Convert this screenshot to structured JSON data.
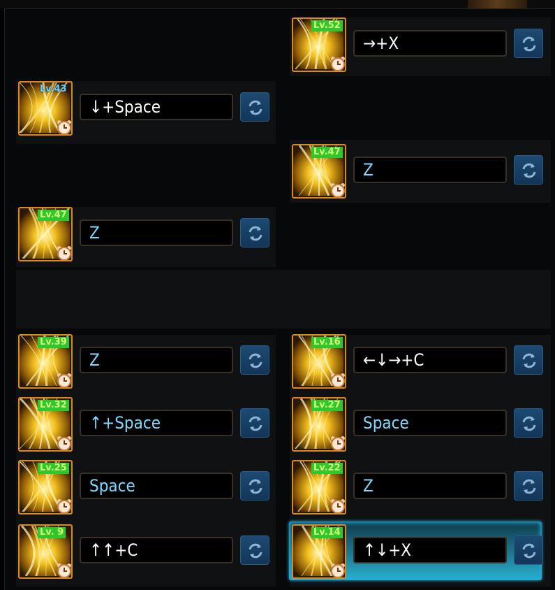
{
  "colors": {
    "frame_bg": "#070809",
    "panel_bg": "#0f1113",
    "icon_border": "#d98a1a",
    "level_badge_bg": "#2ec72e",
    "key_text": "#ffffff",
    "key_text_default": "#7fd9ff",
    "reset_button": "#1c4a72",
    "selected_glow": "#2ab0d0"
  },
  "left_column": [
    {
      "level": "Lv.43",
      "keys": "↓+Space",
      "style": "white",
      "badge": "blue"
    },
    {
      "level": "Lv.47",
      "keys": "Z",
      "style": "cyan",
      "badge": "green"
    },
    {
      "level": "Lv.39",
      "keys": "Z",
      "style": "cyan",
      "badge": "green"
    },
    {
      "level": "Lv.32",
      "keys": "↑+Space",
      "style": "cyan",
      "badge": "green"
    },
    {
      "level": "Lv.25",
      "keys": "Space",
      "style": "cyan",
      "badge": "green"
    },
    {
      "level": "Lv. 9",
      "keys": "↑↑+C",
      "style": "white",
      "badge": "green"
    }
  ],
  "right_column": [
    {
      "level": "Lv.52",
      "keys": "→+X",
      "style": "white",
      "badge": "green"
    },
    {
      "level": "Lv.47",
      "keys": "Z",
      "style": "cyan",
      "badge": "green"
    },
    {
      "level": "Lv.16",
      "keys": "←↓→+C",
      "style": "white",
      "badge": "green"
    },
    {
      "level": "Lv.27",
      "keys": "Space",
      "style": "cyan",
      "badge": "green"
    },
    {
      "level": "Lv.22",
      "keys": "Z",
      "style": "cyan",
      "badge": "green"
    },
    {
      "level": "Lv.14",
      "keys": "↑↓+X",
      "style": "white",
      "badge": "green",
      "selected": true
    }
  ],
  "icons": {
    "skill": "skill-icon",
    "cooldown": "alarm-clock-icon",
    "reset": "reset-arrows-icon"
  }
}
